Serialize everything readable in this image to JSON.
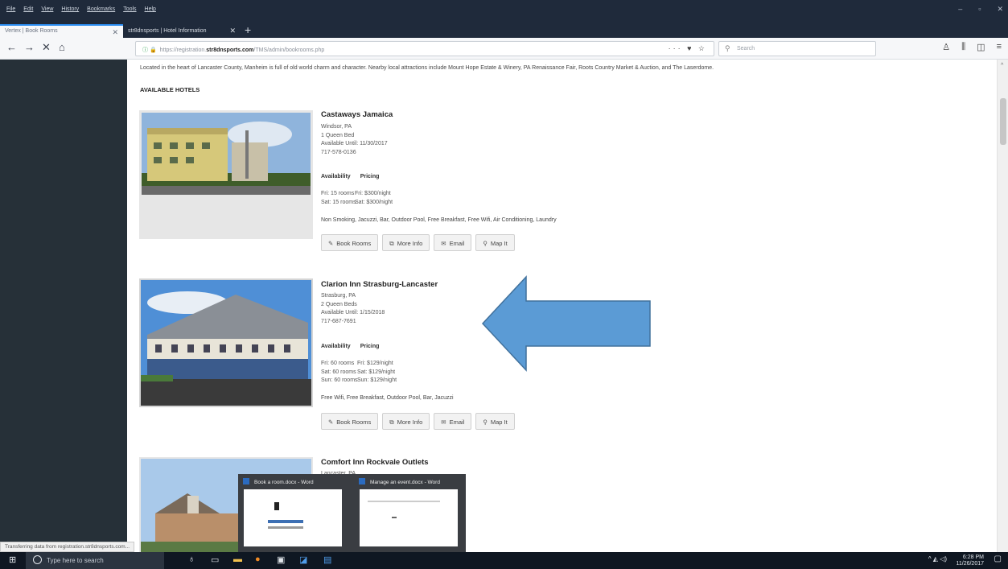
{
  "menubar": {
    "items": [
      "File",
      "Edit",
      "View",
      "History",
      "Bookmarks",
      "Tools",
      "Help"
    ]
  },
  "window_controls": {
    "minimize": "–",
    "restore": "▫",
    "close": "✕"
  },
  "tabs": [
    {
      "label": "Vertex | Book Rooms",
      "close": "✕"
    },
    {
      "label": "str8dnsports | Hotel Information",
      "close": "✕"
    }
  ],
  "new_tab": "+",
  "nav": {
    "back": "←",
    "forward": "→",
    "stop": "✕",
    "home": "⌂"
  },
  "url": {
    "prefix": "https://registration.",
    "domain": "str8dnsports.com",
    "path": "/TMS/admin/bookrooms.php",
    "actions": "··· ♥ ☆"
  },
  "search": {
    "placeholder": "Search"
  },
  "page": {
    "intro": "Located in the heart of Lancaster County, Manheim is full of old world charm and character. Nearby local attractions include Mount Hope Estate & Winery, PA Renaissance Fair, Roots Country Market & Auction, and The Laserdome.",
    "available_title": "AVAILABLE HOTELS"
  },
  "labels": {
    "availability": "Availability",
    "pricing": "Pricing"
  },
  "buttons": {
    "book": "Book Rooms",
    "info": "More Info",
    "email": "Email",
    "map": "Map It"
  },
  "hotels": [
    {
      "name": "Castaways Jamaica",
      "city": "Windsor, PA",
      "beds": "1 Queen Bed",
      "until": "Available Until: 11/30/2017",
      "phone": "717-578-0136",
      "availability": [
        "Fri: 15 rooms",
        "Sat: 15 rooms"
      ],
      "pricing": [
        "Fri: $300/night",
        "Sat: $300/night"
      ],
      "amenities": "Non Smoking, Jacuzzi, Bar, Outdoor Pool, Free Breakfast, Free Wifi, Air Conditioning, Laundry"
    },
    {
      "name": "Clarion Inn Strasburg-Lancaster",
      "city": "Strasburg, PA",
      "beds": "2 Queen Beds",
      "until": "Available Until: 1/15/2018",
      "phone": "717-687-7691",
      "availability": [
        "Fri: 60 rooms",
        "Sat: 60 rooms",
        "Sun: 60 rooms"
      ],
      "pricing": [
        "Fri: $129/night",
        "Sat: $129/night",
        "Sun: $129/night"
      ],
      "amenities": "Free Wifi, Free Breakfast, Outdoor Pool, Bar, Jacuzzi"
    },
    {
      "name": "Comfort Inn Rockvale Outlets",
      "city": "Lancaster, PA"
    }
  ],
  "status_text": "Transferring data from registration.str8dnsports.com...",
  "taskbar": {
    "search_placeholder": "Type here to search",
    "time": "6:28 PM",
    "date": "11/26/2017",
    "tray_icons": "^ ◭ ◁)"
  },
  "thumbnails": [
    {
      "title": "Book a room.docx - Word"
    },
    {
      "title": "Manage an event.docx - Word"
    }
  ],
  "annotation_color": "#5b9bd5"
}
